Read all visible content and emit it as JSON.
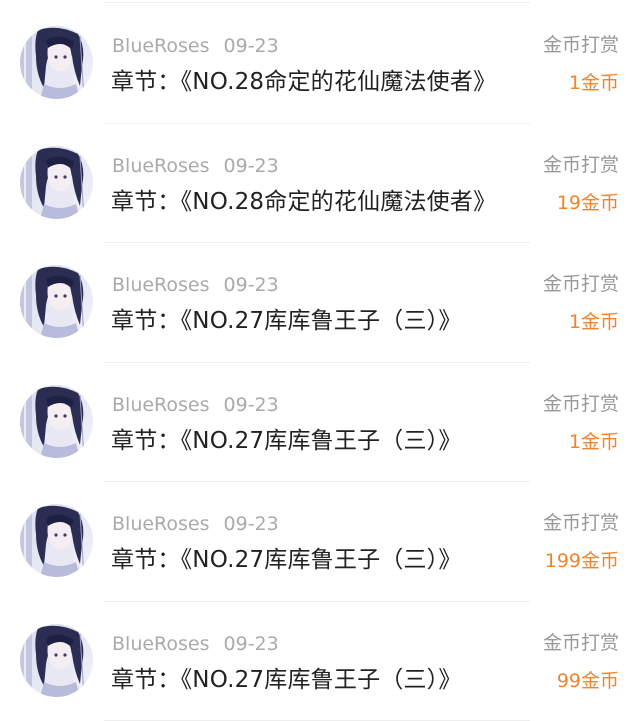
{
  "rewards": [
    {
      "user": "BlueRoses",
      "date": "09-23",
      "chapter_prefix": "章节：",
      "chapter": "《NO.28命定的花仙魔法使者》",
      "type": "金币打赏",
      "amount": "1金币"
    },
    {
      "user": "BlueRoses",
      "date": "09-23",
      "chapter_prefix": "章节：",
      "chapter": "《NO.28命定的花仙魔法使者》",
      "type": "金币打赏",
      "amount": "19金币"
    },
    {
      "user": "BlueRoses",
      "date": "09-23",
      "chapter_prefix": "章节：",
      "chapter": "《NO.27库库鲁王子（三）》",
      "type": "金币打赏",
      "amount": "1金币"
    },
    {
      "user": "BlueRoses",
      "date": "09-23",
      "chapter_prefix": "章节：",
      "chapter": "《NO.27库库鲁王子（三）》",
      "type": "金币打赏",
      "amount": "1金币"
    },
    {
      "user": "BlueRoses",
      "date": "09-23",
      "chapter_prefix": "章节：",
      "chapter": "《NO.27库库鲁王子（三）》",
      "type": "金币打赏",
      "amount": "199金币"
    },
    {
      "user": "BlueRoses",
      "date": "09-23",
      "chapter_prefix": "章节：",
      "chapter": "《NO.27库库鲁王子（三）》",
      "type": "金币打赏",
      "amount": "99金币"
    }
  ],
  "colors": {
    "amount": "#f0842c",
    "meta": "#aaaaaa",
    "chapter": "#222222",
    "reward_type": "#999999",
    "divider": "#eeeeee"
  },
  "icons": {
    "avatar": "anime-girl-avatar-image"
  }
}
